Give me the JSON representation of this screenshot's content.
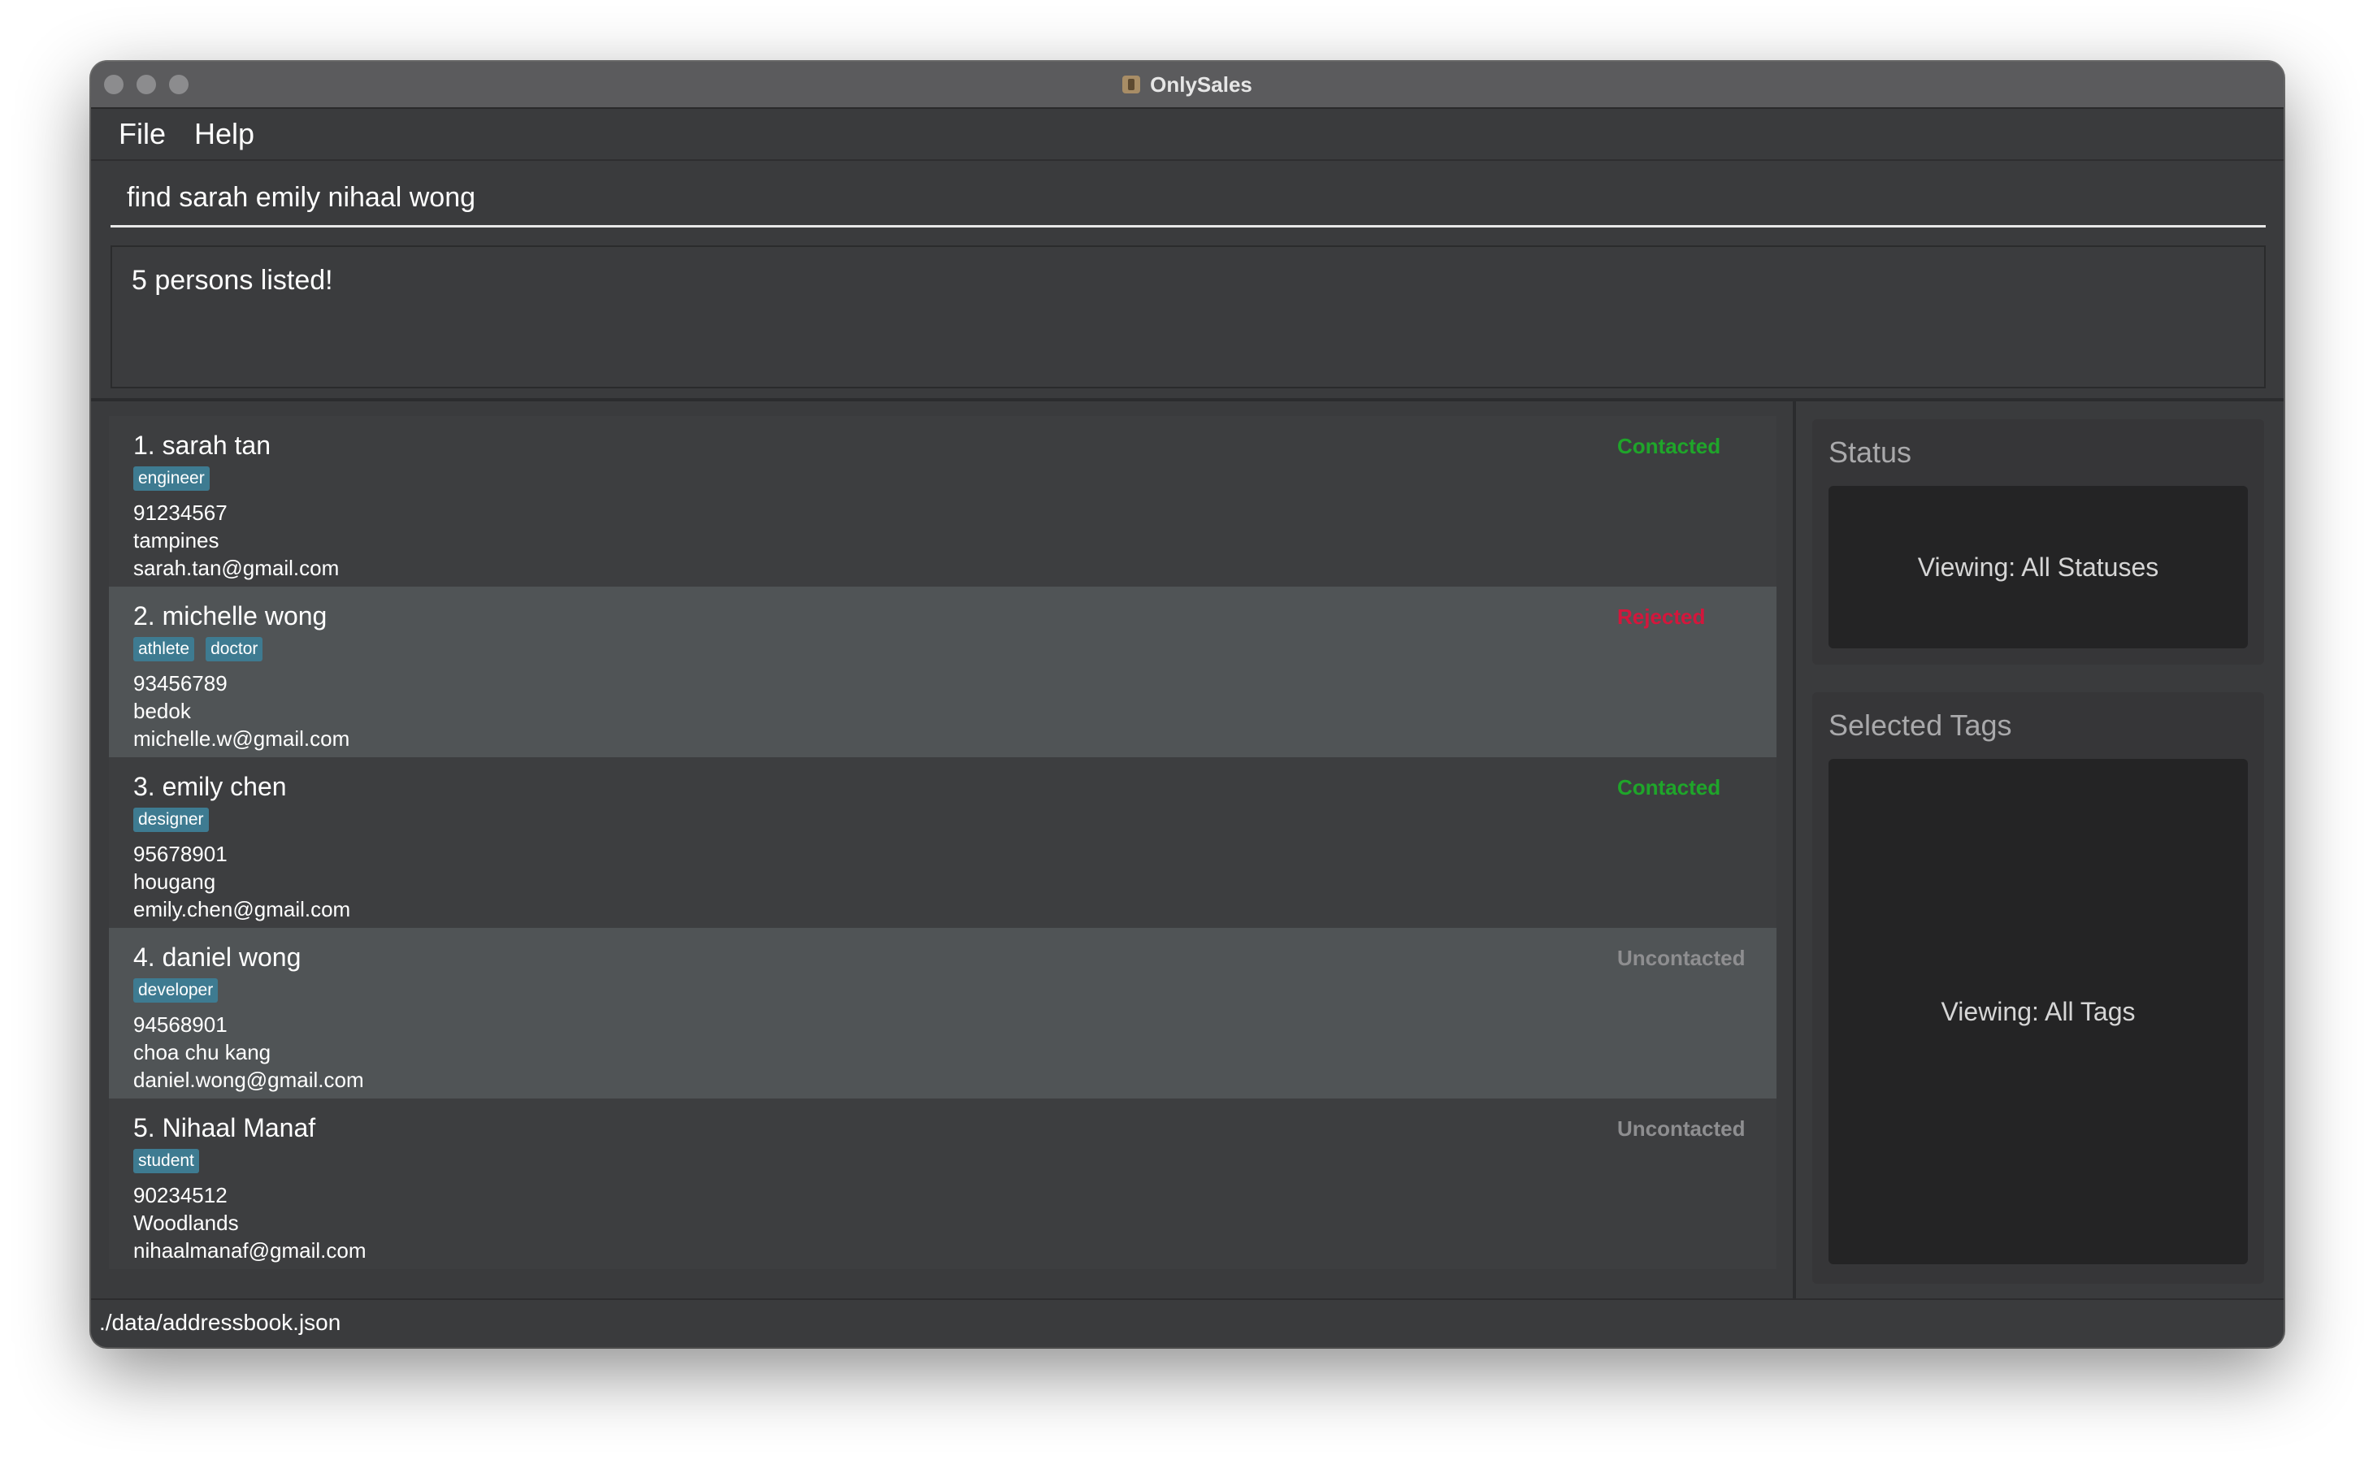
{
  "window": {
    "title": "OnlySales"
  },
  "menu": {
    "items": [
      "File",
      "Help"
    ]
  },
  "command": {
    "value": "find sarah emily nihaal wong"
  },
  "result": {
    "message": "5 persons listed!"
  },
  "persons": [
    {
      "name": "1. sarah tan",
      "tags": [
        "engineer"
      ],
      "phone": "91234567",
      "address": "tampines",
      "email": "sarah.tan@gmail.com",
      "status": "Contacted",
      "status_color": "#1fa52a"
    },
    {
      "name": "2. michelle wong",
      "tags": [
        "athlete",
        "doctor"
      ],
      "phone": "93456789",
      "address": "bedok",
      "email": "michelle.w@gmail.com",
      "status": "Rejected",
      "status_color": "#d4163c"
    },
    {
      "name": "3. emily chen",
      "tags": [
        "designer"
      ],
      "phone": "95678901",
      "address": "hougang",
      "email": "emily.chen@gmail.com",
      "status": "Contacted",
      "status_color": "#1fa52a"
    },
    {
      "name": "4. daniel wong",
      "tags": [
        "developer"
      ],
      "phone": "94568901",
      "address": "choa chu kang",
      "email": "daniel.wong@gmail.com",
      "status": "Uncontacted",
      "status_color": "#8e8e90"
    },
    {
      "name": "5. Nihaal Manaf",
      "tags": [
        "student"
      ],
      "phone": "90234512",
      "address": "Woodlands",
      "email": "nihaalmanaf@gmail.com",
      "status": "Uncontacted",
      "status_color": "#8e8e90"
    }
  ],
  "status_panel": {
    "title": "Status",
    "viewing": "Viewing: All Statuses"
  },
  "tags_panel": {
    "title": "Selected Tags",
    "viewing": "Viewing: All Tags"
  },
  "statusbar": {
    "path": "./data/addressbook.json"
  },
  "colors": {
    "window_bg": "#3a3b3d",
    "card_odd": "#3d3e40",
    "card_even": "#505456",
    "tag_bg": "#3e7b91",
    "titlebar": "#5b5b5d"
  }
}
